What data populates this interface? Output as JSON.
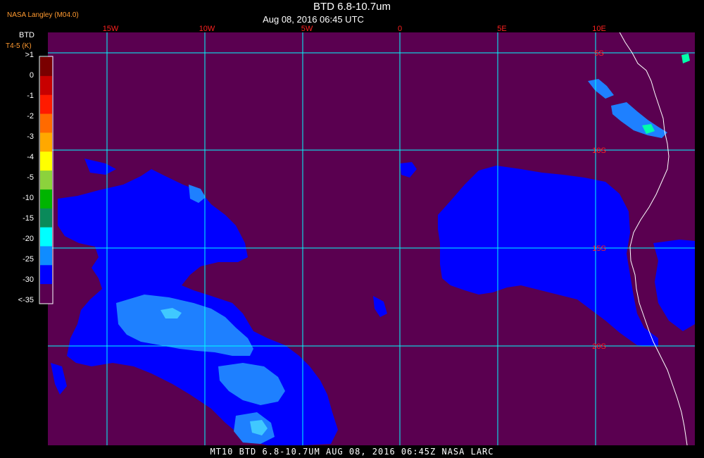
{
  "header": {
    "credit": "NASA Langley (M04.0)",
    "title": "BTD 6.8-10.7um",
    "subtitle": "Aug 08, 2016 06:45 UTC"
  },
  "legend": {
    "title": "BTD",
    "unit": "T4-5 (K)",
    "labels": [
      ">1",
      "0",
      "-1",
      "-2",
      "-3",
      "-4",
      "-5",
      "-10",
      "-15",
      "-20",
      "-25",
      "-30",
      "<-35"
    ],
    "colors": [
      "#7a0000",
      "#c80000",
      "#ff1a00",
      "#ff6a00",
      "#ffa800",
      "#ffff00",
      "#8cd23c",
      "#00b400",
      "#0a8a5a",
      "#00ffff",
      "#0f8cff",
      "#0000ff",
      "#5a0050"
    ]
  },
  "grid": {
    "lon_labels": [
      "15W",
      "10W",
      "5W",
      "0",
      "5E",
      "10E"
    ],
    "lat_labels": [
      "5S",
      "10S",
      "15S",
      "20S"
    ],
    "color": "#00ffff",
    "label_color": "#ff2020"
  },
  "colors": {
    "background": "#5a0050",
    "cloud_deep": "#0000ff",
    "cloud_mid": "#1e80ff",
    "cloud_light": "#40c8ff",
    "coast": "#ffffff"
  },
  "footer": {
    "text": "MT10  BTD 6.8-10.7UM  AUG 08, 2016 06:45Z  NASA LARC"
  }
}
